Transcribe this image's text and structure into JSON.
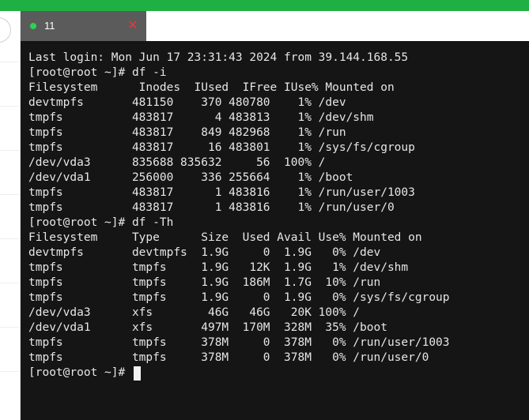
{
  "colors": {
    "top_bar": "#1fb043",
    "tab_bg": "#5b5b5b",
    "tab_status_dot": "#2bd154",
    "tab_close": "#e53935",
    "terminal_bg": "#151515",
    "terminal_fg": "#e6e6e6"
  },
  "tab": {
    "label": "11",
    "status_icon": "status-dot-icon",
    "close_icon": "close-icon",
    "close_glyph": "✕"
  },
  "terminal": {
    "lines": [
      "Last login: Mon Jun 17 23:31:43 2024 from 39.144.168.55",
      "[root@root ~]# df -i",
      "Filesystem      Inodes  IUsed  IFree IUse% Mounted on",
      "devtmpfs       481150    370 480780    1% /dev",
      "tmpfs          483817      4 483813    1% /dev/shm",
      "tmpfs          483817    849 482968    1% /run",
      "tmpfs          483817     16 483801    1% /sys/fs/cgroup",
      "/dev/vda3      835688 835632     56  100% /",
      "/dev/vda1      256000    336 255664    1% /boot",
      "tmpfs          483817      1 483816    1% /run/user/1003",
      "tmpfs          483817      1 483816    1% /run/user/0",
      "[root@root ~]# df -Th",
      "Filesystem     Type      Size  Used Avail Use% Mounted on",
      "devtmpfs       devtmpfs  1.9G     0  1.9G   0% /dev",
      "tmpfs          tmpfs     1.9G   12K  1.9G   1% /dev/shm",
      "tmpfs          tmpfs     1.9G  186M  1.7G  10% /run",
      "tmpfs          tmpfs     1.9G     0  1.9G   0% /sys/fs/cgroup",
      "/dev/vda3      xfs        46G   46G   20K 100% /",
      "/dev/vda1      xfs       497M  170M  328M  35% /boot",
      "tmpfs          tmpfs     378M     0  378M   0% /run/user/1003",
      "tmpfs          tmpfs     378M     0  378M   0% /run/user/0"
    ],
    "prompt": "[root@root ~]# "
  }
}
